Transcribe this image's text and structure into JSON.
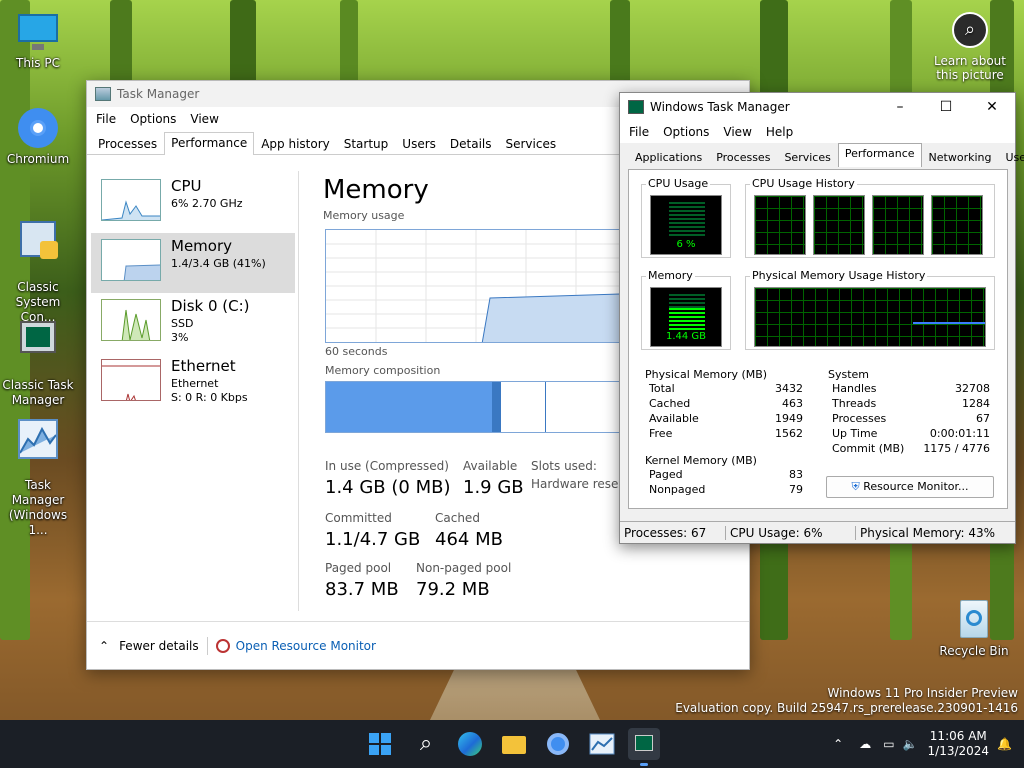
{
  "desktop": {
    "icons": [
      {
        "label": "This PC",
        "icon": "monitor-icon"
      },
      {
        "label": "Chromium",
        "icon": "chromium-icon"
      },
      {
        "label": "Classic\nSystem Con...",
        "icon": "control-panel-icon"
      },
      {
        "label": "Classic Task\nManager",
        "icon": "task-manager-icon"
      },
      {
        "label": "Task Manager\n(Windows 1...",
        "icon": "task-manager-chart-icon"
      },
      {
        "label": "Recycle Bin",
        "icon": "recycle-bin-icon"
      }
    ],
    "learn": "Learn about\nthis picture",
    "watermark_line1": "Windows 11 Pro Insider Preview",
    "watermark_line2": "Evaluation copy. Build 25947.rs_prerelease.230901-1416"
  },
  "tm": {
    "title": "Task Manager",
    "menu": [
      "File",
      "Options",
      "View"
    ],
    "tabs": [
      "Processes",
      "Performance",
      "App history",
      "Startup",
      "Users",
      "Details",
      "Services"
    ],
    "active_tab": "Performance",
    "resources": [
      {
        "name": "CPU",
        "sub1": "6% 2.70 GHz",
        "sub2": ""
      },
      {
        "name": "Memory",
        "sub1": "1.4/3.4 GB (41%)",
        "sub2": ""
      },
      {
        "name": "Disk 0 (C:)",
        "sub1": "SSD",
        "sub2": "3%"
      },
      {
        "name": "Ethernet",
        "sub1": "Ethernet",
        "sub2": "S: 0 R: 0 Kbps"
      }
    ],
    "heading": "Memory",
    "usage_label": "Memory usage",
    "seconds": "60 seconds",
    "composition_label": "Memory composition",
    "stats": {
      "in_use_k": "In use (Compressed)",
      "in_use_v": "1.4 GB (0 MB)",
      "available_k": "Available",
      "available_v": "1.9 GB",
      "slots_k": "Slots used:",
      "hw_k": "Hardware reserve",
      "committed_k": "Committed",
      "committed_v": "1.1/4.7 GB",
      "cached_k": "Cached",
      "cached_v": "464 MB",
      "paged_k": "Paged pool",
      "paged_v": "83.7 MB",
      "nonpaged_k": "Non-paged pool",
      "nonpaged_v": "79.2 MB"
    },
    "fewer": "Fewer details",
    "open_rm": "Open Resource Monitor"
  },
  "ctm": {
    "title": "Windows Task Manager",
    "menu": [
      "File",
      "Options",
      "View",
      "Help"
    ],
    "tabs": [
      "Applications",
      "Processes",
      "Services",
      "Performance",
      "Networking",
      "Users"
    ],
    "cpu_usage_title": "CPU Usage",
    "cpu_usage_value": "6 %",
    "cpu_history_title": "CPU Usage History",
    "memory_title": "Memory",
    "memory_value": "1.44 GB",
    "pm_history_title": "Physical Memory Usage History",
    "physical": {
      "title": "Physical Memory (MB)",
      "rows": [
        [
          "Total",
          "3432"
        ],
        [
          "Cached",
          "463"
        ],
        [
          "Available",
          "1949"
        ],
        [
          "Free",
          "1562"
        ]
      ]
    },
    "system": {
      "title": "System",
      "rows": [
        [
          "Handles",
          "32708"
        ],
        [
          "Threads",
          "1284"
        ],
        [
          "Processes",
          "67"
        ],
        [
          "Up Time",
          "0:00:01:11"
        ],
        [
          "Commit (MB)",
          "1175 / 4776"
        ]
      ]
    },
    "kernel": {
      "title": "Kernel Memory (MB)",
      "rows": [
        [
          "Paged",
          "83"
        ],
        [
          "Nonpaged",
          "79"
        ]
      ]
    },
    "resource_monitor_btn": "Resource Monitor...",
    "status": [
      "Processes: 67",
      "CPU Usage: 6%",
      "Physical Memory: 43%"
    ]
  },
  "taskbar": {
    "time": "11:06 AM",
    "date": "1/13/2024"
  }
}
